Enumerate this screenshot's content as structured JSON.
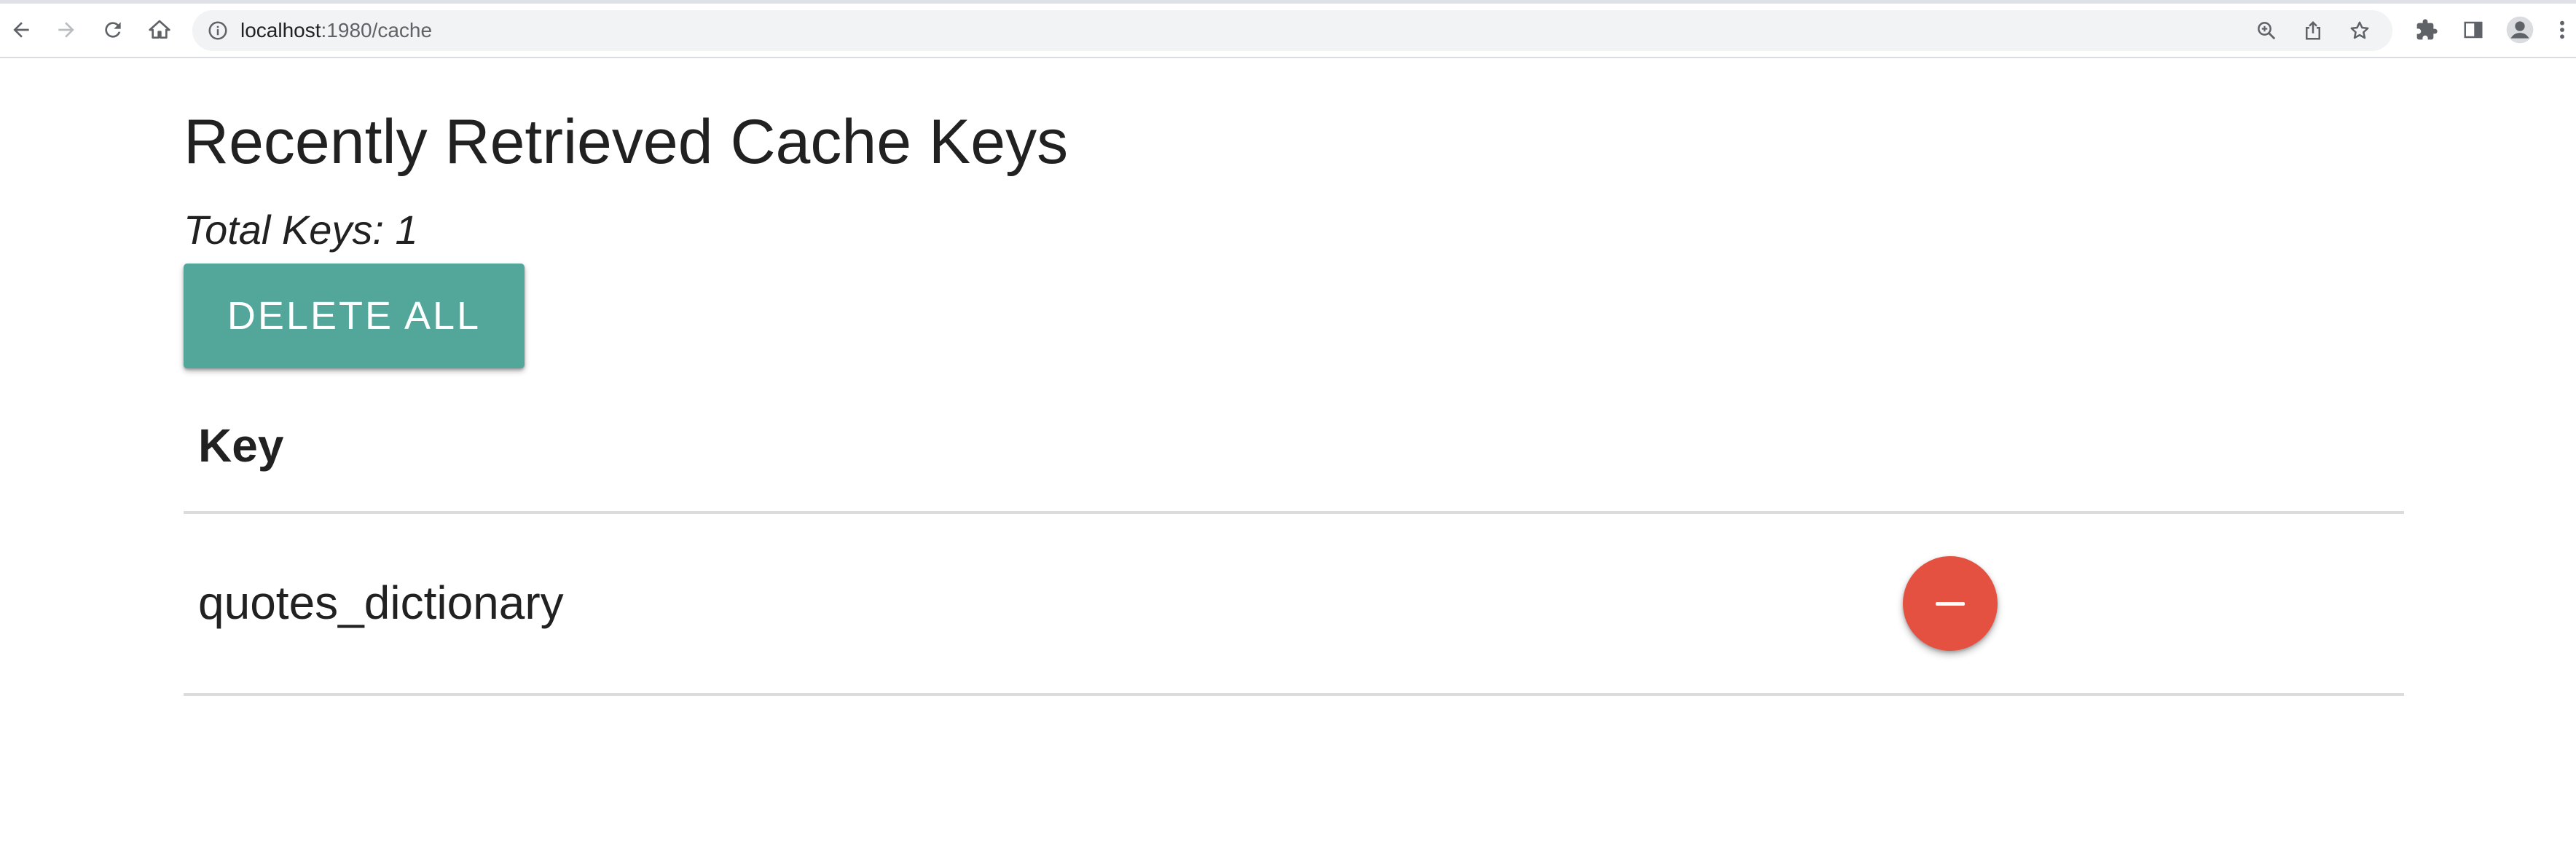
{
  "browser": {
    "url_host": "localhost",
    "url_path": ":1980/cache",
    "icons": {
      "back": "arrow-left-icon",
      "forward": "arrow-right-icon",
      "reload": "reload-icon",
      "home": "home-icon",
      "site_info": "info-icon",
      "zoom": "zoom-icon",
      "share": "share-icon",
      "bookmark": "star-icon",
      "extensions": "puzzle-icon",
      "side_panel": "side-panel-icon",
      "profile": "profile-icon",
      "menu": "kebab-menu-icon"
    }
  },
  "page": {
    "title": "Recently Retrieved Cache Keys",
    "total_keys": "Total Keys: 1",
    "delete_all_label": "DELETE ALL",
    "table": {
      "column_key": "Key",
      "rows": [
        {
          "key": "quotes_dictionary"
        }
      ]
    }
  },
  "colors": {
    "delete_all": "#52a69a",
    "remove": "#e45140",
    "text": "#212121"
  }
}
